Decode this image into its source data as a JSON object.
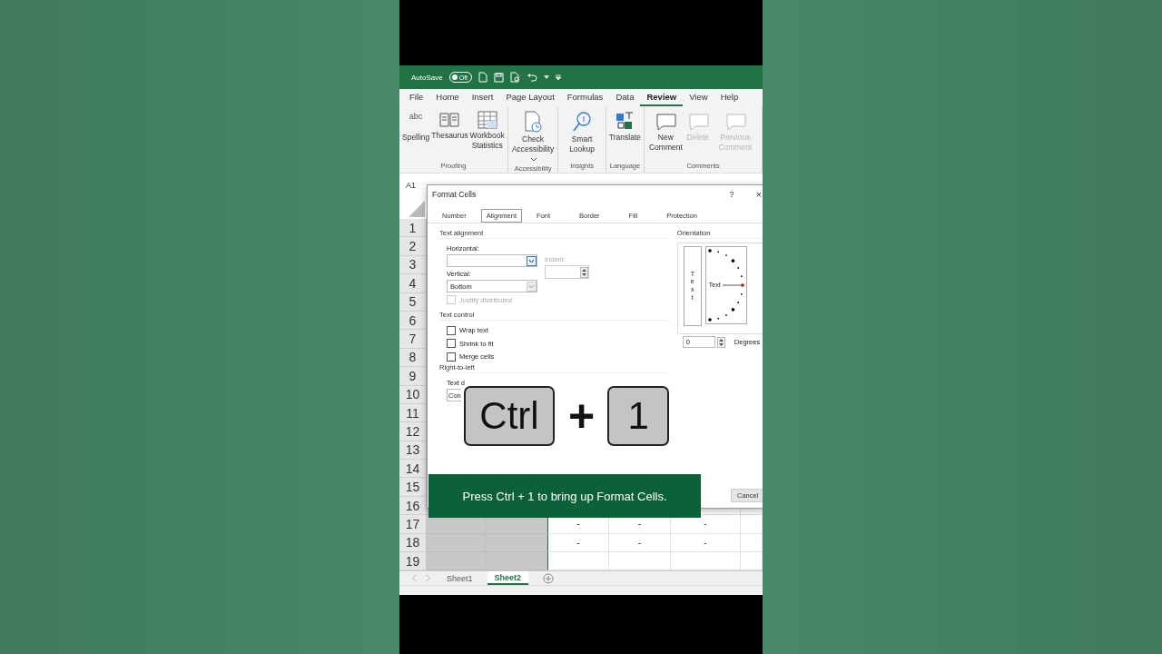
{
  "title_bar": {
    "autosave_label": "AutoSave",
    "autosave_toggle": {
      "label": "Off",
      "on": false
    }
  },
  "menu_tabs": [
    {
      "label": "File",
      "selected": false
    },
    {
      "label": "Home",
      "selected": false
    },
    {
      "label": "Insert",
      "selected": false
    },
    {
      "label": "Page Layout",
      "selected": false
    },
    {
      "label": "Formulas",
      "selected": false
    },
    {
      "label": "Data",
      "selected": false
    },
    {
      "label": "Review",
      "selected": true
    },
    {
      "label": "View",
      "selected": false
    },
    {
      "label": "Help",
      "selected": false
    }
  ],
  "ribbon_groups": [
    {
      "label": "Proofing",
      "commands": [
        {
          "kind": "spelling",
          "icon_text": "abc",
          "label": "Spelling",
          "disabled": false
        },
        {
          "kind": "thesaurus",
          "label": "Thesaurus",
          "disabled": false
        },
        {
          "kind": "statistics",
          "label": "Workbook Statistics",
          "disabled": false
        }
      ]
    },
    {
      "label": "Accessibility",
      "commands": [
        {
          "kind": "accessibility",
          "label": "Check Accessibility",
          "dropdown": true,
          "disabled": false
        }
      ]
    },
    {
      "label": "Insights",
      "commands": [
        {
          "kind": "lookup",
          "label": "Smart Lookup",
          "disabled": false
        }
      ]
    },
    {
      "label": "Language",
      "commands": [
        {
          "kind": "translate",
          "label": "Translate",
          "disabled": false
        }
      ]
    },
    {
      "label": "Comments",
      "commands": [
        {
          "kind": "comment",
          "label": "New Comment",
          "disabled": false
        },
        {
          "kind": "comment",
          "label": "Delete",
          "disabled": true
        },
        {
          "kind": "comment",
          "label": "Previous Comment",
          "disabled": true
        }
      ]
    }
  ],
  "name_box": "A1",
  "grid": {
    "rows": [
      {
        "header": "1"
      },
      {
        "header": "2"
      },
      {
        "header": "3"
      },
      {
        "header": "4"
      },
      {
        "header": "5"
      },
      {
        "header": "6"
      },
      {
        "header": "7"
      },
      {
        "header": "8"
      },
      {
        "header": "9"
      },
      {
        "header": "10"
      },
      {
        "header": "11"
      },
      {
        "header": "12"
      },
      {
        "header": "13"
      },
      {
        "header": "14"
      },
      {
        "header": "15"
      },
      {
        "header": "16"
      },
      {
        "header": "17",
        "cells": [
          "-",
          "-",
          "-"
        ]
      },
      {
        "header": "18",
        "cells": [
          "-",
          "-",
          "-"
        ]
      },
      {
        "header": "19"
      }
    ]
  },
  "sheet_tabs": [
    {
      "label": "Sheet1",
      "selected": false
    },
    {
      "label": "Sheet2",
      "selected": true
    }
  ],
  "dialog": {
    "title": "Format Cells",
    "help": "?",
    "close": "×",
    "tabs": [
      {
        "label": "Number",
        "selected": false
      },
      {
        "label": "Alignment",
        "selected": true
      },
      {
        "label": "Font",
        "selected": false
      },
      {
        "label": "Border",
        "selected": false
      },
      {
        "label": "Fill",
        "selected": false
      },
      {
        "label": "Protection",
        "selected": false
      }
    ],
    "text_alignment": {
      "heading": "Text alignment",
      "horizontal_label": "Horizontal:",
      "indent_label": "Indent:",
      "vertical_label": "Vertical:",
      "vertical_value": "Bottom",
      "justify": {
        "label": "Justify distributed",
        "checked": false,
        "disabled": true
      }
    },
    "text_control": {
      "heading": "Text control",
      "options": [
        {
          "label": "Wrap text",
          "checked": false
        },
        {
          "label": "Shrink to fit",
          "checked": false
        },
        {
          "label": "Merge cells",
          "checked": false
        }
      ]
    },
    "right_to_left": {
      "heading": "Right-to-left",
      "direction_label": "Text d",
      "direction_value": "Con"
    },
    "orientation": {
      "heading": "Orientation",
      "vertical_text": "Text",
      "dial_text": "Text",
      "degrees_value": "0",
      "degrees_label": "Degrees"
    },
    "buttons": [
      "Cancel"
    ]
  },
  "shortcut_overlay": {
    "keys": [
      "Ctrl",
      "1"
    ],
    "joiner": "+",
    "caption": "Press Ctrl + 1 to bring up Format Cells."
  }
}
